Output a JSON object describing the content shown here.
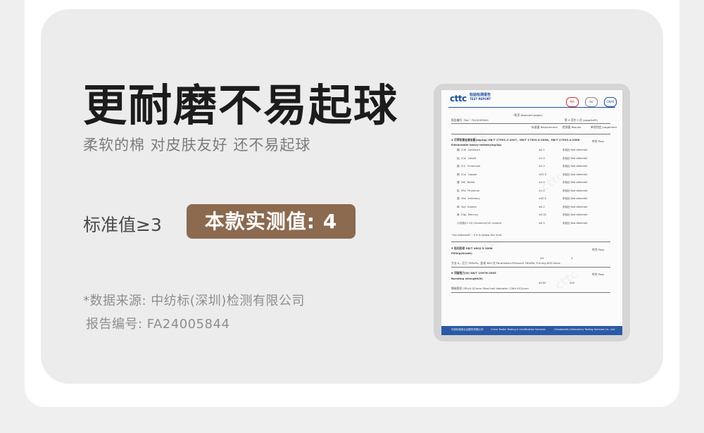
{
  "headline": "更耐磨不易起球",
  "subtitle": "柔软的棉 对皮肤友好 还不易起球",
  "standard_label": "标准值≥3",
  "measured_label": "本款实测值: 4",
  "source_note": "*数据来源: 中纺标(深圳)检测有限公司",
  "report_no_note": "报告编号: FA24005844",
  "report": {
    "logo": "cttc",
    "logo_cn": "检验检测报告",
    "logo_en": "TEST REPORT",
    "marks": [
      "MA",
      "ilac",
      "CNAS"
    ],
    "attached": "（附页 Attached pages）",
    "report_no": "报告编号（No.）FA24005844",
    "page": "第 4 页共 5 页 (page4of5)",
    "col_req": "标准值 Requirement",
    "col_res": "检测值 Results",
    "col_judge": "单项判定 Judgement",
    "sec4_title": "4 可萃取重金属含量(mg/kg) GB/T 17593.2-2007，GB/T 17593.3-2006，GB/T 17593.4-2006",
    "sec4_en": "Extractable heavy-metals(mg/kg)",
    "sec4_judge": "符合 Pass",
    "metals": [
      {
        "name": "镉（Cd）Cadmium",
        "req": "≤0.1",
        "res": "未检出 Not detected"
      },
      {
        "name": "钴（Co）Cobalt",
        "req": "≤1.0",
        "res": "未检出 Not detected"
      },
      {
        "name": "铬（Cr）Chromium",
        "req": "≤2.0",
        "res": "未检出 Not detected"
      },
      {
        "name": "铜（Cu）Copper",
        "req": "≤25.0",
        "res": "未检出 Not detected"
      },
      {
        "name": "镍（Ni）Nickel",
        "req": "≤1.0",
        "res": "未检出 Not detected"
      },
      {
        "name": "铅（Pb）Plumbum",
        "req": "≤1.0",
        "res": "未检出 Not detected"
      },
      {
        "name": "锑（Sb）Antimony",
        "req": "≤30.0",
        "res": "未检出 Not detected"
      },
      {
        "name": "砷（As）Arsenic",
        "req": "≤0.2",
        "res": "未检出 Not detected"
      },
      {
        "name": "汞（Hg）Mercury",
        "req": "≤0.02",
        "res": "未检出 Not detected"
      },
      {
        "name": "六价铬(Cr VI) Chromium(VI) content",
        "req": "≤0.5",
        "res": "未检出 Not detected"
      }
    ],
    "sec4_note": "\"not detected\" : if it is below the limit.",
    "sec5_title": "5 起毛起球 GB/T 4802.3-2008",
    "sec5_en": "Pilling(Grade)",
    "sec5_req": "≥3",
    "sec5_res": "4",
    "sec5_judge": "符合 Pass",
    "sec5_cond": "方法 A，压力 780kPa，起毛 600 次 Parameters:Pressure 780kPa, Turning 600 times",
    "sec6_title": "6 顶破强力(N) GB/T 19976-2005",
    "sec6_en": "Bursting strength(N)",
    "sec6_req": "≥250",
    "sec6_res": "442",
    "sec6_judge": "符合 Pass",
    "sec6_cond": "钢球直径 (38±0.02)mm Steel ball diameter: (38±0.02)mm",
    "footer_left": "中纺标检验认证股份有限公司",
    "footer_mid": "China Textile Testing & Certification Services",
    "footer_right": "Chinatextile (Shenzhen) Testing Services Co., Ltd."
  }
}
